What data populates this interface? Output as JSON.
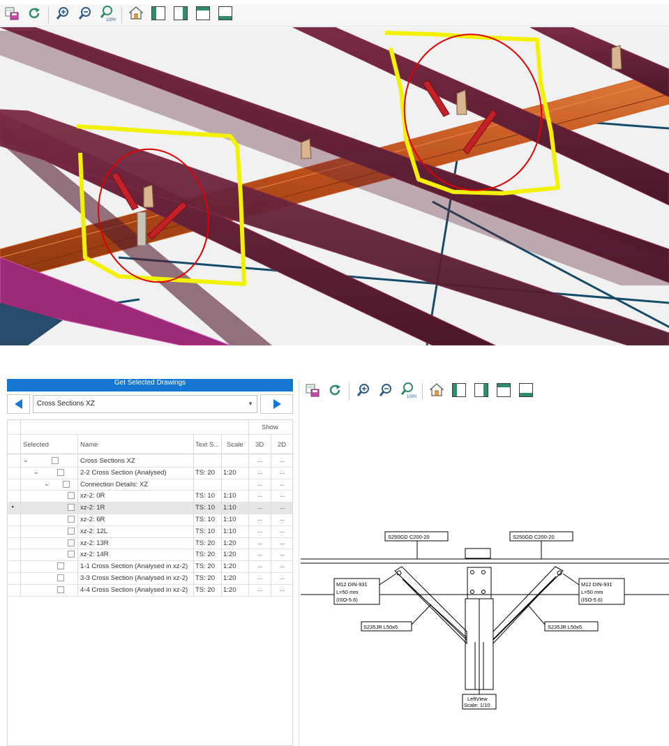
{
  "toolbar": {
    "buttons": [
      "save-icon",
      "refresh-icon",
      "zoom-in-icon",
      "zoom-out-icon",
      "zoom-100-icon",
      "home-icon",
      "panel-left-icon",
      "panel-right-icon",
      "panel-top-icon",
      "panel-bottom-icon"
    ],
    "zoom_100_label": "100%"
  },
  "model_view": {
    "colors": {
      "beam": "#5a1f33",
      "girder": "#b24f1e",
      "brace": "#174b68",
      "highlight": "#f2f200",
      "circle": "#e00000"
    }
  },
  "drawings_panel": {
    "get_button_label": "Get Selected Drawings",
    "selected_drawing": "Cross Sections XZ",
    "columns": {
      "group_show": "Show",
      "selected": "Selected",
      "name": "Name",
      "text_size": "Text S...",
      "scale": "Scale",
      "view_3d": "3D",
      "view_2d": "2D"
    },
    "rows": [
      {
        "name": "Cross Sections XZ",
        "ts": "",
        "scale": "",
        "view_3d": "...",
        "view_2d": "..."
      },
      {
        "name": "2-2 Cross Section (Analysed)",
        "ts": "TS: 20",
        "scale": "1:20",
        "view_3d": "...",
        "view_2d": "..."
      },
      {
        "name": "Connection Details: XZ",
        "ts": "",
        "scale": "",
        "view_3d": "...",
        "view_2d": "..."
      },
      {
        "name": "xz-2: 0R",
        "ts": "TS: 10",
        "scale": "1:10",
        "view_3d": "...",
        "view_2d": "..."
      },
      {
        "name": "xz-2: 1R",
        "ts": "TS: 10",
        "scale": "1:10",
        "view_3d": "...",
        "view_2d": "..."
      },
      {
        "name": "xz-2: 6R",
        "ts": "TS: 10",
        "scale": "1:10",
        "view_3d": "...",
        "view_2d": "..."
      },
      {
        "name": "xz-2: 12L",
        "ts": "TS: 10",
        "scale": "1:10",
        "view_3d": "...",
        "view_2d": "..."
      },
      {
        "name": "xz-2: 13R",
        "ts": "TS: 20",
        "scale": "1:20",
        "view_3d": "...",
        "view_2d": "..."
      },
      {
        "name": "xz-2: 14R",
        "ts": "TS: 20",
        "scale": "1:20",
        "view_3d": "...",
        "view_2d": "..."
      },
      {
        "name": "1-1 Cross Section (Analysed in xz-2)",
        "ts": "TS: 20",
        "scale": "1:20",
        "view_3d": "...",
        "view_2d": "..."
      },
      {
        "name": "3-3 Cross Section (Analysed in xz-2)",
        "ts": "TS: 20",
        "scale": "1:20",
        "view_3d": "...",
        "view_2d": "..."
      },
      {
        "name": "4-4 Cross Section (Analysed in xz-2)",
        "ts": "TS: 20",
        "scale": "1:20",
        "view_3d": "...",
        "view_2d": "..."
      }
    ],
    "colors": {
      "accent": "#1477d2",
      "selected_row": "#e6e6e6"
    }
  },
  "drawing_viewer": {
    "labels": {
      "purlin_left": "S250GD C200-20",
      "purlin_right": "S250GD C200-20",
      "bolt_left": [
        "M12 DIN-931",
        "L=50 mm",
        "(ISO-5.6)"
      ],
      "bolt_right": [
        "M12 DIN-931",
        "L=50 mm",
        "(ISO-5.6)"
      ],
      "angle_left": "S235JR L50x5",
      "angle_right": "S235JR L50x5",
      "view_title": "LeftView",
      "view_scale": "Scale: 1/10"
    }
  }
}
